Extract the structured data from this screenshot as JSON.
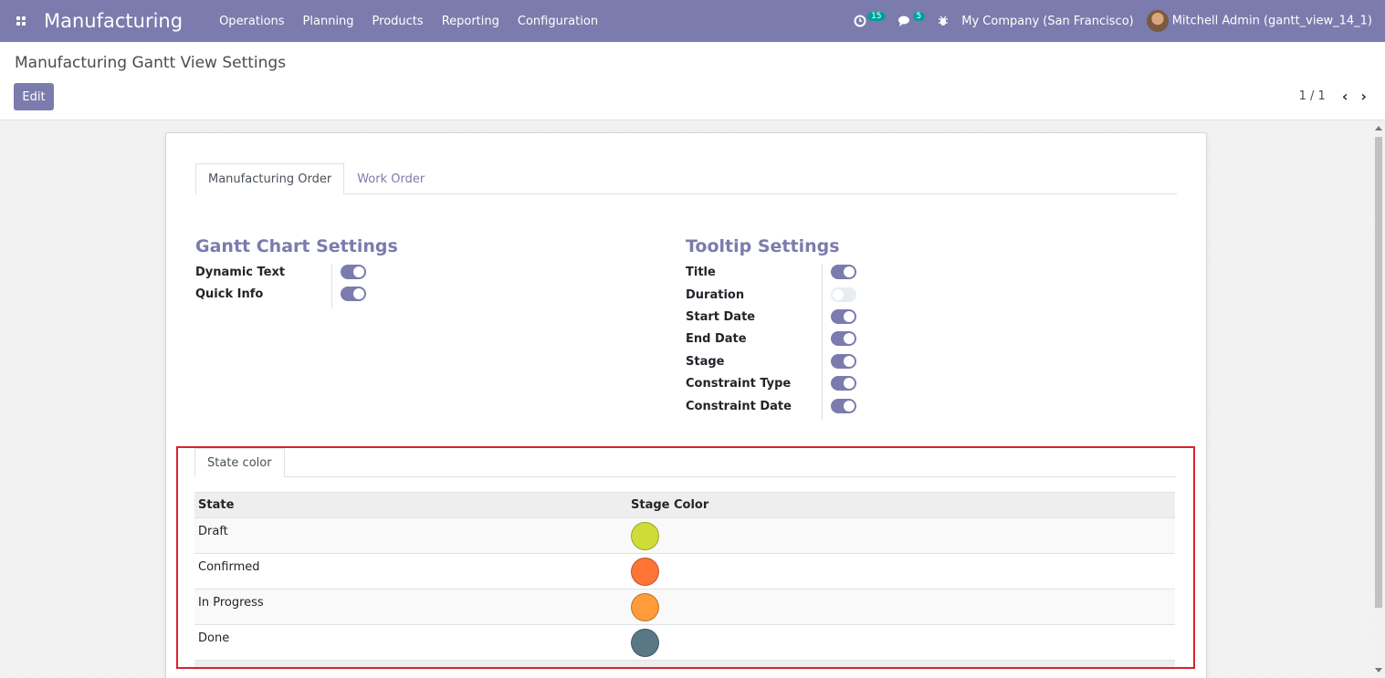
{
  "navbar": {
    "brand": "Manufacturing",
    "menu": [
      "Operations",
      "Planning",
      "Products",
      "Reporting",
      "Configuration"
    ],
    "activity_count": "15",
    "message_count": "5",
    "company": "My Company (San Francisco)",
    "user": "Mitchell Admin (gantt_view_14_1)"
  },
  "control_panel": {
    "breadcrumb": "Manufacturing Gantt View Settings",
    "edit_label": "Edit",
    "pager": "1 / 1",
    "prev": "‹",
    "next": "›"
  },
  "tabs": [
    "Manufacturing Order",
    "Work Order"
  ],
  "gantt_settings": {
    "title": "Gantt Chart Settings",
    "items": [
      {
        "label": "Dynamic Text",
        "enabled": true
      },
      {
        "label": "Quick Info",
        "enabled": true
      }
    ]
  },
  "tooltip_settings": {
    "title": "Tooltip Settings",
    "items": [
      {
        "label": "Title",
        "enabled": true
      },
      {
        "label": "Duration",
        "enabled": false
      },
      {
        "label": "Start Date",
        "enabled": true
      },
      {
        "label": "End Date",
        "enabled": true
      },
      {
        "label": "Stage",
        "enabled": true
      },
      {
        "label": "Constraint Type",
        "enabled": true
      },
      {
        "label": "Constraint Date",
        "enabled": true
      }
    ]
  },
  "state_color": {
    "tab_label": "State color",
    "columns": [
      "State",
      "Stage Color"
    ],
    "rows": [
      {
        "state": "Draft",
        "color": "#cddc39"
      },
      {
        "state": "Confirmed",
        "color": "#ff7336"
      },
      {
        "state": "In Progress",
        "color": "#ff9b38"
      },
      {
        "state": "Done",
        "color": "#5a7785"
      }
    ]
  }
}
